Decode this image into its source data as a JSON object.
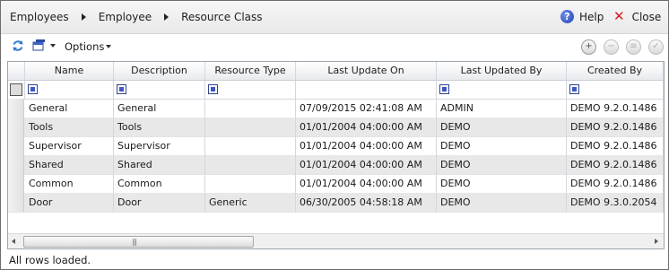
{
  "breadcrumb": [
    "Employees",
    "Employee",
    "Resource Class"
  ],
  "header": {
    "help_label": "Help",
    "close_label": "Close"
  },
  "toolbar": {
    "options_label": "Options"
  },
  "grid": {
    "columns": [
      "Name",
      "Description",
      "Resource Type",
      "Last Update On",
      "Last Updated By",
      "Created By"
    ],
    "rows": [
      [
        "General",
        "General",
        "",
        "07/09/2015 02:41:08 AM",
        "ADMIN",
        "DEMO 9.2.0.1486"
      ],
      [
        "Tools",
        "Tools",
        "",
        "01/01/2004 04:00:00 AM",
        "DEMO",
        "DEMO 9.2.0.1486"
      ],
      [
        "Supervisor",
        "Supervisor",
        "",
        "01/01/2004 04:00:00 AM",
        "DEMO",
        "DEMO 9.2.0.1486"
      ],
      [
        "Shared",
        "Shared",
        "",
        "01/01/2004 04:00:00 AM",
        "DEMO",
        "DEMO 9.2.0.1486"
      ],
      [
        "Common",
        "Common",
        "",
        "01/01/2004 04:00:00 AM",
        "DEMO",
        "DEMO 9.2.0.1486"
      ],
      [
        "Door",
        "Door",
        "Generic",
        "06/30/2005 04:58:18 AM",
        "DEMO",
        "DEMO 9.3.0.2054"
      ]
    ]
  },
  "status": {
    "text": "All rows loaded."
  },
  "colors": {
    "alt_row": "#e8e8e8",
    "close_icon": "#d62020",
    "help_icon": "#1d3fb5"
  }
}
